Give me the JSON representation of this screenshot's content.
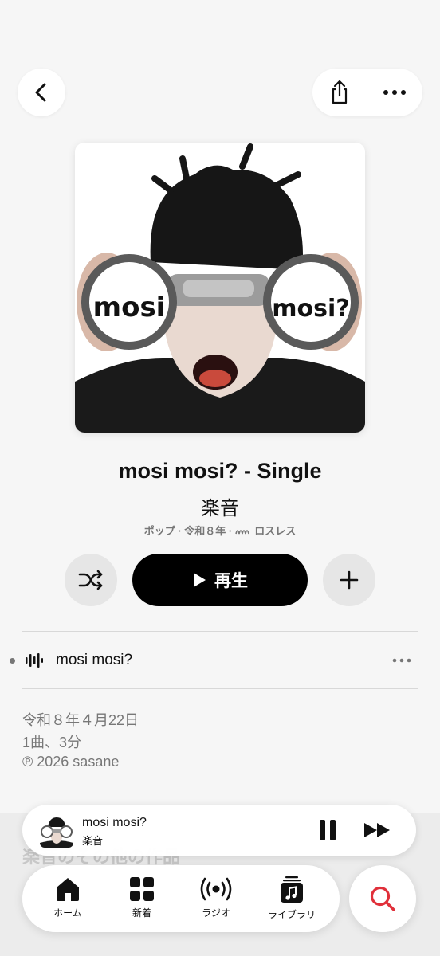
{
  "nav": {
    "back_icon": "chevron-left-icon",
    "share_icon": "share-icon",
    "more_icon": "ellipsis-icon"
  },
  "album": {
    "artwork_text_left": "mosi",
    "artwork_text_right": "mosi?",
    "title": "mosi mosi? - Single",
    "artist": "楽音",
    "meta_genre": "ポップ · 令和８年 · ",
    "meta_lossless": "ロスレス"
  },
  "controls": {
    "shuffle_icon": "shuffle-icon",
    "play_label": "再生",
    "add_icon": "plus-icon"
  },
  "tracks": [
    {
      "title": "mosi mosi?"
    }
  ],
  "info": {
    "release_date": "令和８年４月22日",
    "summary": "1曲、3分",
    "copyright": "℗ 2026 sasane"
  },
  "more_section": {
    "title": "楽音のその他の作品"
  },
  "mini_player": {
    "title": "mosi mosi?",
    "artist": "楽音"
  },
  "tabs": [
    {
      "label": "ホーム",
      "icon": "home-icon"
    },
    {
      "label": "新着",
      "icon": "grid-icon"
    },
    {
      "label": "ラジオ",
      "icon": "radio-icon"
    },
    {
      "label": "ライブラリ",
      "icon": "library-icon"
    }
  ],
  "colors": {
    "accent": "#e0303a",
    "background": "#f6f6f6",
    "primary_button": "#000000"
  }
}
